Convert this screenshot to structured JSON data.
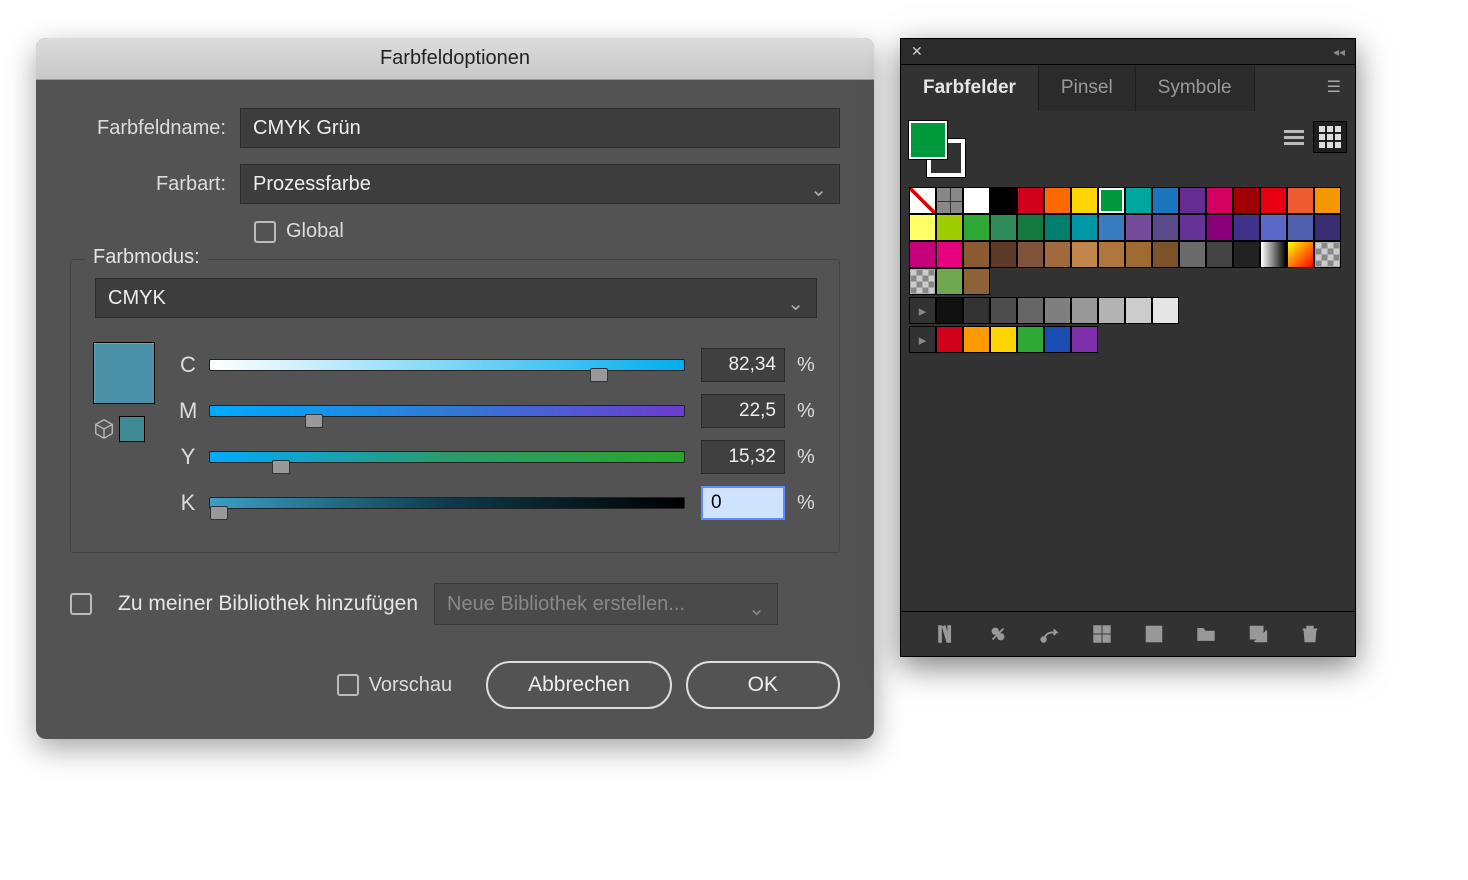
{
  "dialog": {
    "title": "Farbfeldoptionen",
    "name_label": "Farbfeldname:",
    "name_value": "CMYK Grün",
    "type_label": "Farbart:",
    "type_value": "Prozessfarbe",
    "global_label": "Global",
    "mode_label": "Farbmodus:",
    "mode_value": "CMYK",
    "channels": {
      "c": {
        "label": "C",
        "value": "82,34",
        "pct": 82.34
      },
      "m": {
        "label": "M",
        "value": "22,5",
        "pct": 22.5
      },
      "y": {
        "label": "Y",
        "value": "15,32",
        "pct": 15.32
      },
      "k": {
        "label": "K",
        "value": "0",
        "pct": 0
      }
    },
    "percent": "%",
    "preview_hex": "#4b91a8",
    "alt_preview_hex": "#3e8b93",
    "lib_checkbox": "Zu meiner Bibliothek hinzufügen",
    "lib_select": "Neue Bibliothek erstellen...",
    "preview_label": "Vorschau",
    "cancel": "Abbrechen",
    "ok": "OK"
  },
  "panel": {
    "tabs": [
      "Farbfelder",
      "Pinsel",
      "Symbole"
    ],
    "active_tab": 0,
    "fill_color": "#009a3d",
    "rows": [
      [
        "none",
        "reg",
        "#ffffff",
        "#000000",
        "#d0021b",
        "#ff6a00",
        "#ffd500",
        "#009a3d:sel",
        "#00a79d",
        "#1b75bc",
        "#662d91",
        "#d60060",
        "#a00000",
        "#e60012",
        "#ed5c2e",
        "#f39800"
      ],
      [
        "#ffff66",
        "#9fce00",
        "#2fa836",
        "#2e8b57",
        "#157a3e",
        "#007f6f",
        "#0097a7",
        "#3a7cc0",
        "#754c9a",
        "#5a4a8c",
        "#663399",
        "#88007a",
        "#40328a",
        "#5a68c8",
        "#4e5fae",
        "#3b2d73"
      ],
      [
        "#c4007a",
        "#e6007e",
        "#8a5a33",
        "#5c3a26",
        "#80543a",
        "#a06a3c",
        "#c2854a",
        "#b0773c",
        "#9e6b32",
        "#7c5228",
        "#6a6a6a",
        "#444444",
        "#222222",
        "grad-h",
        "grad-o",
        "check"
      ],
      [
        "check",
        "#6fa84f",
        "#8c6239"
      ]
    ],
    "groups": [
      {
        "colors": [
          "#111111",
          "#333333",
          "#4d4d4d",
          "#666666",
          "#7f7f7f",
          "#999999",
          "#b3b3b3",
          "#cccccc",
          "#e6e6e6"
        ]
      },
      {
        "colors": [
          "#d0021b",
          "#ff9900",
          "#ffd500",
          "#2fa836",
          "#1b4db3",
          "#7c2fa8"
        ]
      }
    ]
  }
}
